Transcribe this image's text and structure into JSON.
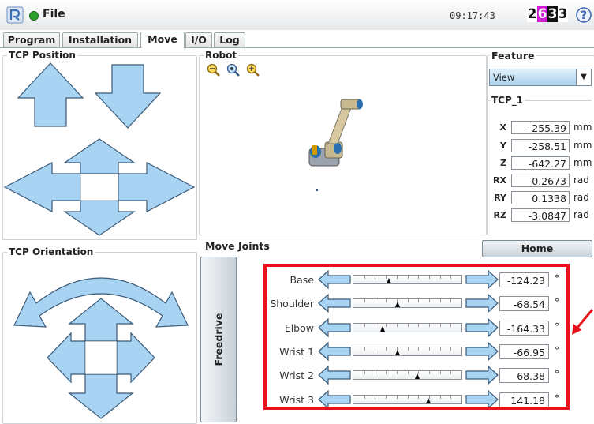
{
  "header": {
    "file_label": "File",
    "clock": "09:17:43",
    "counter": [
      {
        "digit": "2",
        "bg": "#ffffff",
        "fg": "#111111"
      },
      {
        "digit": "6",
        "bg": "#d01bd0",
        "fg": "#ffffff"
      },
      {
        "digit": "3",
        "bg": "#111111",
        "fg": "#ffffff"
      },
      {
        "digit": "3",
        "bg": "#ffffff",
        "fg": "#111111"
      }
    ]
  },
  "tabs": [
    {
      "label": "Program",
      "active": false
    },
    {
      "label": "Installation",
      "active": false
    },
    {
      "label": "Move",
      "active": true
    },
    {
      "label": "I/O",
      "active": false
    },
    {
      "label": "Log",
      "active": false
    }
  ],
  "groups": {
    "tcp_position": "TCP Position",
    "robot": "Robot",
    "feature": "Feature",
    "tcp_name": "TCP_1",
    "tcp_orientation": "TCP Orientation",
    "move_joints": "Move Joints"
  },
  "feature_value": "View",
  "tcp_coords": [
    {
      "label": "X",
      "value": "-255.39",
      "unit": "mm"
    },
    {
      "label": "Y",
      "value": "-258.51",
      "unit": "mm"
    },
    {
      "label": "Z",
      "value": "-642.27",
      "unit": "mm"
    },
    {
      "label": "RX",
      "value": "0.2673",
      "unit": "rad"
    },
    {
      "label": "RY",
      "value": "0.1338",
      "unit": "rad"
    },
    {
      "label": "RZ",
      "value": "-3.0847",
      "unit": "rad"
    }
  ],
  "home_label": "Home",
  "freedrive_label": "Freedrive",
  "joints": [
    {
      "name": "Base",
      "value": "-124.23",
      "unit": "°",
      "slider": 0.33
    },
    {
      "name": "Shoulder",
      "value": "-68.54",
      "unit": "°",
      "slider": 0.41
    },
    {
      "name": "Elbow",
      "value": "-164.33",
      "unit": "°",
      "slider": 0.27
    },
    {
      "name": "Wrist 1",
      "value": "-66.95",
      "unit": "°",
      "slider": 0.41
    },
    {
      "name": "Wrist 2",
      "value": "68.38",
      "unit": "°",
      "slider": 0.59
    },
    {
      "name": "Wrist 3",
      "value": "141.18",
      "unit": "°",
      "slider": 0.69
    }
  ],
  "icons": {
    "logo": "ur-logo-icon",
    "status": "status-dot-icon",
    "help": "help-icon",
    "zoom": [
      "zoom-out-icon",
      "zoom-reset-icon",
      "zoom-in-icon"
    ]
  },
  "colors": {
    "arrow_fill": "#a9d3f2",
    "arrow_stroke": "#3a5a78",
    "highlight": "#e8101a"
  }
}
